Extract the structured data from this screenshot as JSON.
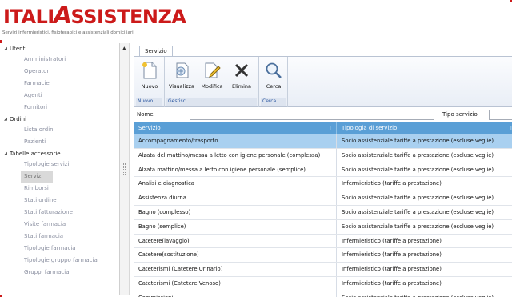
{
  "app": {
    "logo_prefix": "ITALI",
    "logo_a": "A",
    "logo_suffix": "SSISTENZA",
    "tagline": "Servizi infermieristici, fisioterapici e assistenziali domiciliari"
  },
  "colors": {
    "brand": "#cc1a1a",
    "grid_header": "#5a9fd6",
    "selected_row": "#a9d0f0",
    "ribbon_footer_text": "#2a56a0"
  },
  "sidebar": {
    "groups": [
      {
        "label": "Utenti",
        "items": [
          "Amministratori",
          "Operatori",
          "Farmacie",
          "Agenti",
          "Fornitori"
        ]
      },
      {
        "label": "Ordini",
        "items": [
          "Lista ordini",
          "Pazienti"
        ]
      },
      {
        "label": "Tabelle accessorie",
        "items": [
          "Tipologie servizi",
          "Servizi",
          "Rimborsi",
          "Stati ordine",
          "Stati fatturazione",
          "Visite farmacia",
          "Stati farmacia",
          "Tipologie farmacia",
          "Tipologie gruppo farmacia",
          "Gruppi farmacia"
        ]
      }
    ],
    "selected": "Servizi"
  },
  "ribbon": {
    "tab": "Servizio",
    "buttons": {
      "nuovo": "Nuovo",
      "visualizza": "Visualizza",
      "modifica": "Modifica",
      "elimina": "Elimina",
      "cerca": "Cerca"
    },
    "groups": {
      "nuovo": "Nuovo",
      "gestisci": "Gestisci",
      "cerca": "Cerca"
    }
  },
  "filters": {
    "name_label": "Nome",
    "name_value": "",
    "type_label": "Tipo servizio",
    "type_value": ""
  },
  "grid": {
    "columns": [
      "Servizio",
      "Tipologia di servizio"
    ],
    "rows": [
      [
        "Accompagnamento/trasporto",
        "Socio assistenziale tariffe a prestazione (escluse veglie)"
      ],
      [
        "Alzata del mattino/messa a letto con igiene personale (complessa)",
        "Socio assistenziale tariffe a prestazione (escluse veglie)"
      ],
      [
        "Alzata mattino/messa a letto con igiene personale (semplice)",
        "Socio assistenziale tariffe a prestazione (escluse veglie)"
      ],
      [
        "Analisi e diagnostica",
        "Infermieristico (tariffe a prestazione)"
      ],
      [
        "Assistenza diurna",
        "Socio assistenziale tariffe a prestazione (escluse veglie)"
      ],
      [
        "Bagno (complesso)",
        "Socio assistenziale tariffe a prestazione (escluse veglie)"
      ],
      [
        "Bagno (semplice)",
        "Socio assistenziale tariffe a prestazione (escluse veglie)"
      ],
      [
        "Catetere(lavaggio)",
        "Infermieristico (tariffe a prestazione)"
      ],
      [
        "Catetere(sostituzione)",
        "Infermieristico (tariffe a prestazione)"
      ],
      [
        "Cateterismi (Catetere Urinario)",
        "Infermieristico (tariffe a prestazione)"
      ],
      [
        "Cateterismi (Catetere Venoso)",
        "Infermieristico (tariffe a prestazione)"
      ],
      [
        "Commissioni",
        "Socio assistenziale tariffe a prestazione (escluse veglie)"
      ]
    ],
    "selected_row": 0
  }
}
